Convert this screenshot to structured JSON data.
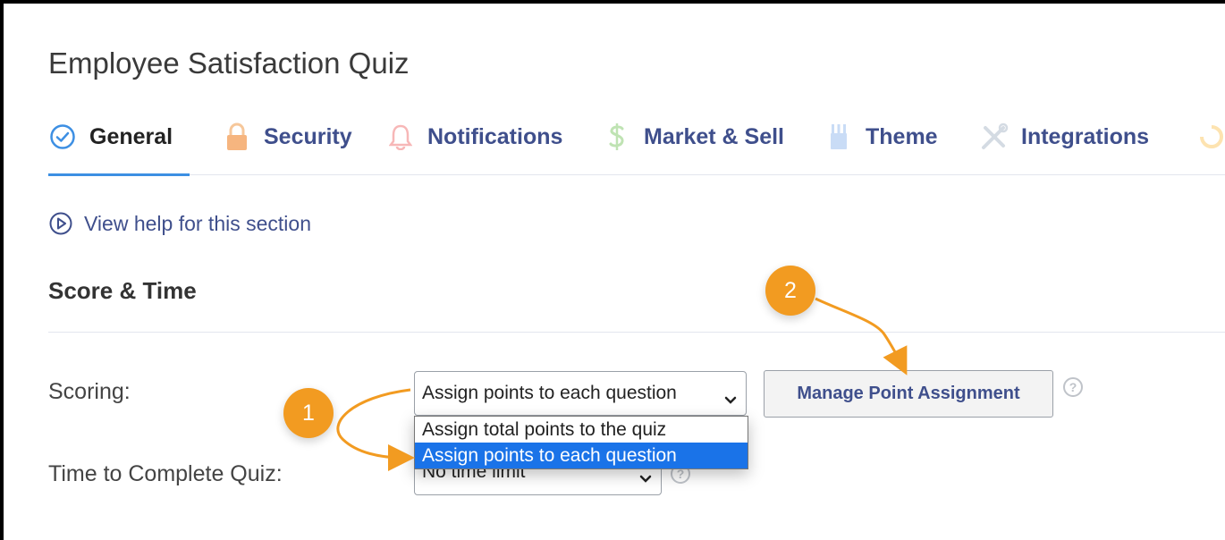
{
  "page": {
    "title": "Employee Satisfaction Quiz"
  },
  "tabs": [
    {
      "label": "General",
      "icon": "check-circle-icon",
      "active": true
    },
    {
      "label": "Security",
      "icon": "lock-icon"
    },
    {
      "label": "Notifications",
      "icon": "bell-icon"
    },
    {
      "label": "Market & Sell",
      "icon": "dollar-icon"
    },
    {
      "label": "Theme",
      "icon": "brush-icon"
    },
    {
      "label": "Integrations",
      "icon": "tools-icon"
    }
  ],
  "help": {
    "label": "View help for this section"
  },
  "section": {
    "title": "Score & Time"
  },
  "scoring": {
    "label": "Scoring:",
    "selected": "Assign points to each question",
    "options": [
      "Assign total points to the quiz",
      "Assign points to each question"
    ],
    "manage_button": "Manage Point Assignment"
  },
  "time": {
    "label": "Time to Complete Quiz:",
    "selected": "No time limit"
  },
  "annotations": [
    "1",
    "2"
  ],
  "colors": {
    "accent": "#3d8fe3",
    "tab_text": "#3f4f8c",
    "badge": "#f29b21",
    "selected_option": "#1a73e8"
  }
}
